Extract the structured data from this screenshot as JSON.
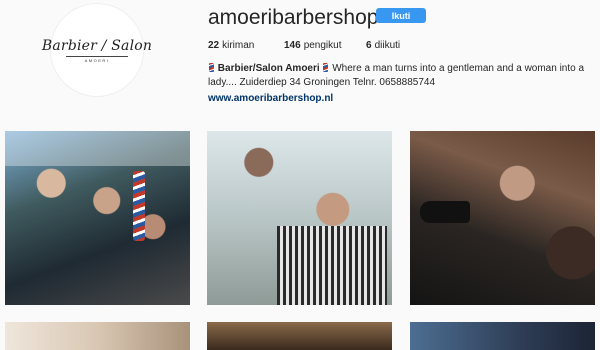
{
  "profile": {
    "username": "amoeribarbershop",
    "follow_label": "Ikuti",
    "avatar": {
      "logo_text": "Barbier / Salon",
      "logo_sub": "AMOERI"
    },
    "stats": {
      "posts_count": "22",
      "posts_label": "kiriman",
      "followers_count": "146",
      "followers_label": "pengikut",
      "following_count": "6",
      "following_label": "diikuti"
    },
    "bio": {
      "name": "Barbier/Salon Amoeri",
      "text": "Where a man turns into a gentleman and a woman into a lady.... Zuiderdiep 34 Groningen Telnr. 0658885744",
      "website": "www.amoeribarbershop.nl"
    }
  },
  "grid": {
    "tiles": [
      {
        "label": ""
      },
      {
        "label": ""
      },
      {
        "label": ""
      },
      {
        "label": ""
      },
      {
        "label": ""
      },
      {
        "label": ""
      }
    ]
  },
  "colors": {
    "accent": "#3897f0",
    "link": "#003569",
    "background": "#fafafa"
  }
}
